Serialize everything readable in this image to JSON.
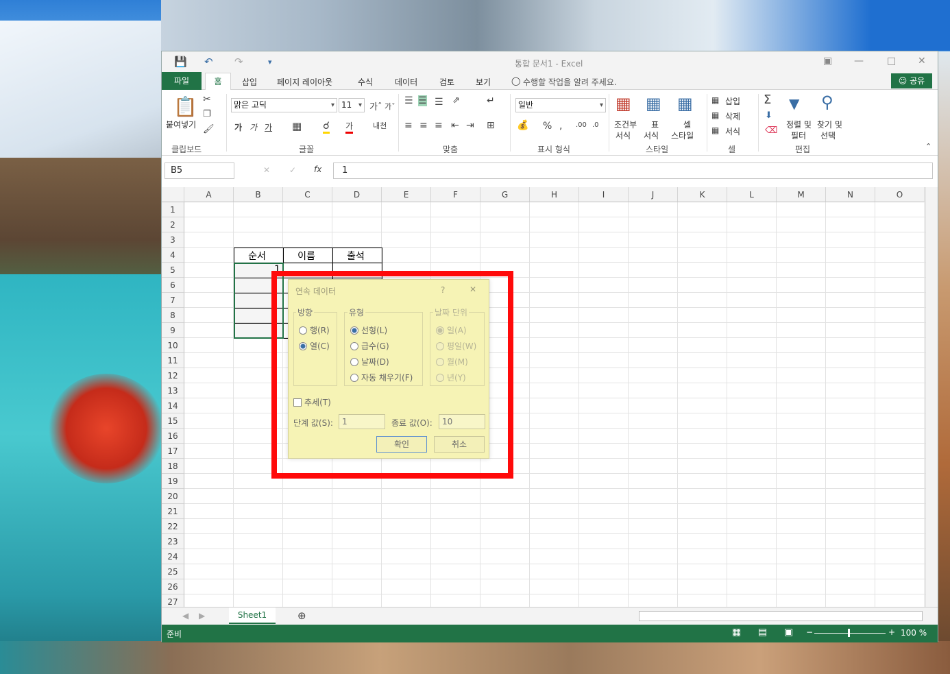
{
  "window": {
    "title": "통합 문서1 - Excel"
  },
  "tabs": [
    "파일",
    "홈",
    "삽입",
    "페이지 레이아웃",
    "수식",
    "데이터",
    "검토",
    "보기"
  ],
  "tell_me": "수행할 작업을 알려 주세요.",
  "share": "공유",
  "ribbon": {
    "clipboard": {
      "paste": "붙여넣기",
      "group": "클립보드"
    },
    "font": {
      "name": "맑은 고딕",
      "size": "11",
      "group": "글꼴"
    },
    "align": {
      "group": "맞춤"
    },
    "number": {
      "format": "일반",
      "group": "표시 형식"
    },
    "styles": {
      "conditional": "조건부",
      "conditional2": "서식",
      "table": "표",
      "table2": "서식",
      "cell": "셀",
      "cell2": "스타일",
      "group": "스타일"
    },
    "cells": {
      "insert": "삽입",
      "delete": "삭제",
      "format": "서식",
      "group": "셀"
    },
    "editing": {
      "sort": "정렬 및",
      "sort2": "필터",
      "find": "찾기 및",
      "find2": "선택",
      "group": "편집"
    }
  },
  "formula_bar": {
    "name_box": "B5",
    "value": "1"
  },
  "columns": [
    "A",
    "B",
    "C",
    "D",
    "E",
    "F",
    "G",
    "H",
    "I",
    "J",
    "K",
    "L",
    "M",
    "N",
    "O"
  ],
  "rows": [
    "1",
    "2",
    "3",
    "4",
    "5",
    "6",
    "7",
    "8",
    "9",
    "10",
    "11",
    "12",
    "13",
    "14",
    "15",
    "16",
    "17",
    "18",
    "19",
    "20",
    "21",
    "22",
    "23",
    "24",
    "25",
    "26",
    "27"
  ],
  "cells": {
    "b4": "순서",
    "c4": "이름",
    "d4": "출석",
    "b5": "1"
  },
  "sheet": {
    "tab": "Sheet1"
  },
  "status": {
    "ready": "준비",
    "zoom": "100 %"
  },
  "dialog": {
    "title": "연속 데이터",
    "help": "?",
    "close": "✕",
    "direction": {
      "label": "방향",
      "row": "행(R)",
      "col": "열(C)"
    },
    "type": {
      "label": "유형",
      "linear": "선형(L)",
      "growth": "급수(G)",
      "date": "날짜(D)",
      "autofill": "자동 채우기(F)"
    },
    "date_unit": {
      "label": "날짜 단위",
      "day": "일(A)",
      "weekday": "평일(W)",
      "month": "월(M)",
      "year": "년(Y)"
    },
    "trend": "추세(T)",
    "step_label": "단계 값(S):",
    "step_value": "1",
    "stop_label": "종료 값(O):",
    "stop_value": "10",
    "ok": "확인",
    "cancel": "취소"
  },
  "colors": {
    "accent": "#217346",
    "highlight": "#ff0a0a",
    "dialog_bg": "#f6f3b5"
  }
}
